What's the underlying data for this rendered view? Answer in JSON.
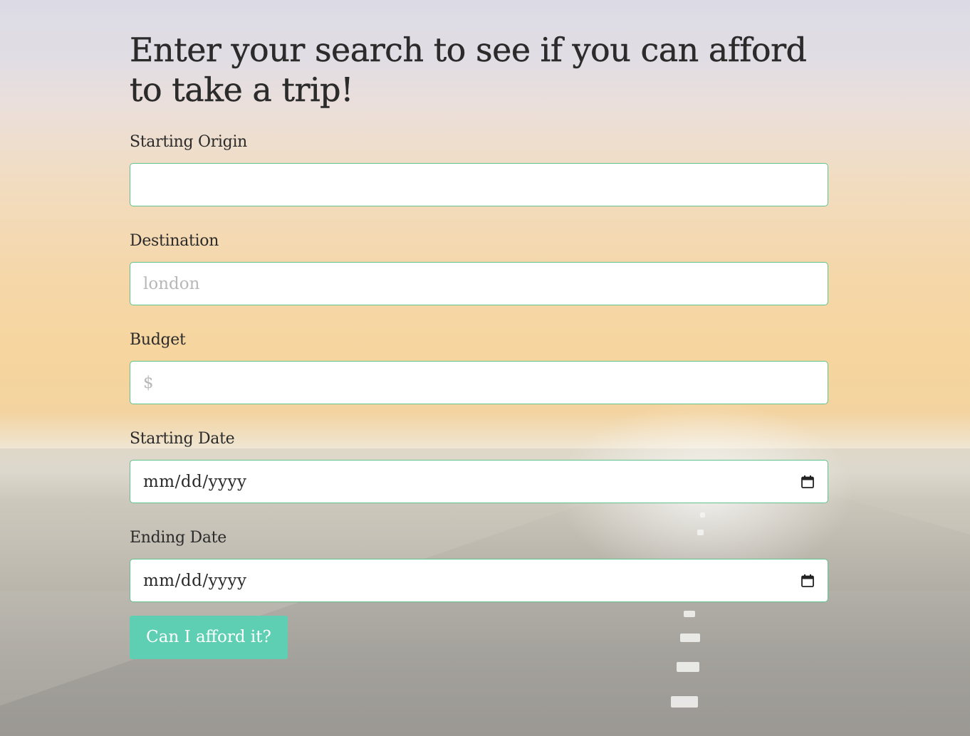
{
  "page": {
    "heading": "Enter your search to see if you can afford to take a trip!"
  },
  "form": {
    "origin": {
      "label": "Starting Origin",
      "placeholder": "",
      "value": ""
    },
    "destination": {
      "label": "Destination",
      "placeholder": "london",
      "value": ""
    },
    "budget": {
      "label": "Budget",
      "placeholder": "$",
      "value": ""
    },
    "start_date": {
      "label": "Starting Date",
      "placeholder": "mm/dd/yyyy",
      "icon": "calendar-icon"
    },
    "end_date": {
      "label": "Ending Date",
      "placeholder": "mm/dd/yyyy",
      "icon": "calendar-icon"
    },
    "submit_label": "Can I afford it?"
  },
  "colors": {
    "input_border": "#5fc48b",
    "button_bg": "#5fcfb4",
    "button_text": "#ffffff",
    "text": "#2b2b2b",
    "placeholder": "#b8b8b8"
  }
}
